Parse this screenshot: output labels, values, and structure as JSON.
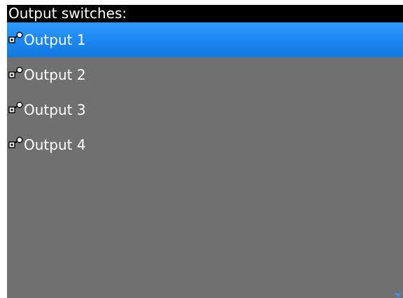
{
  "title_bar": {
    "text": "Output switches:"
  },
  "list": {
    "items": [
      {
        "label": "Output 1",
        "icon": "key-lock-icon",
        "selected": true
      },
      {
        "label": "Output 2",
        "icon": "key-lock-icon",
        "selected": false
      },
      {
        "label": "Output 3",
        "icon": "key-lock-icon",
        "selected": false
      },
      {
        "label": "Output 4",
        "icon": "key-lock-icon",
        "selected": false
      }
    ]
  },
  "colors": {
    "title_background": "#000000",
    "list_background": "#707070",
    "selection_highlight": "#1a86f0",
    "text": "#ffffff",
    "scroll_arrow": "#3d8ee6"
  },
  "scroll_indicator": {
    "icon": "scroll-down-arrow-icon"
  }
}
